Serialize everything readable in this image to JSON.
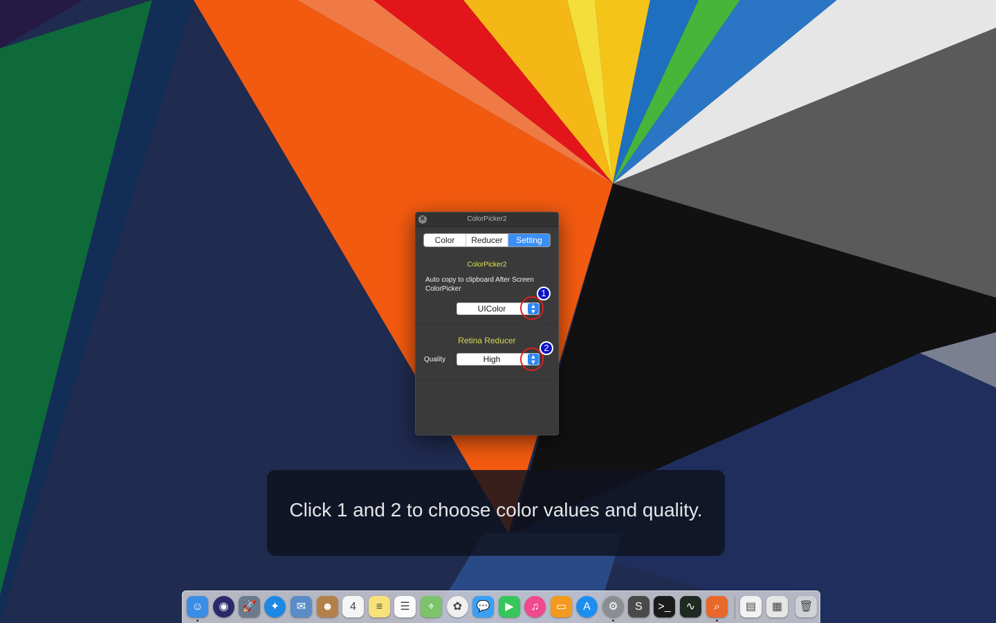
{
  "window": {
    "title": "ColorPicker2",
    "tabs": [
      "Color",
      "Reducer",
      "Setting"
    ],
    "active_tab": "Setting",
    "section1": {
      "title": "ColorPicker2",
      "description": "Auto copy to clipboard After Screen ColorPicker",
      "format_value": "UIColor"
    },
    "section2": {
      "title": "Retina Reducer",
      "quality_label": "Quality",
      "quality_value": "High"
    }
  },
  "annotations": {
    "marker1": "1",
    "marker2": "2"
  },
  "caption": "Click 1 and 2 to choose color values and quality.",
  "dock": {
    "items": [
      {
        "name": "finder-icon",
        "glyph": "☺",
        "color": "#3a8ee6"
      },
      {
        "name": "siri-icon",
        "glyph": "◉",
        "color": "#2a2a6a"
      },
      {
        "name": "launchpad-icon",
        "glyph": "🚀",
        "color": "#6c7a8e"
      },
      {
        "name": "safari-icon",
        "glyph": "✦",
        "color": "#1e88e5"
      },
      {
        "name": "mail-icon",
        "glyph": "✉",
        "color": "#5a8dc8"
      },
      {
        "name": "contacts-icon",
        "glyph": "☻",
        "color": "#b3804a"
      },
      {
        "name": "calendar-icon",
        "glyph": "4",
        "color": "#f5f5f5"
      },
      {
        "name": "notes-icon",
        "glyph": "≡",
        "color": "#f7e27a"
      },
      {
        "name": "reminders-icon",
        "glyph": "☰",
        "color": "#fafafa"
      },
      {
        "name": "maps-icon",
        "glyph": "⌖",
        "color": "#7cc36a"
      },
      {
        "name": "photos-icon",
        "glyph": "✿",
        "color": "#f0f0f0"
      },
      {
        "name": "messages-icon",
        "glyph": "💬",
        "color": "#3aa0f5"
      },
      {
        "name": "facetime-icon",
        "glyph": "▶",
        "color": "#35c759"
      },
      {
        "name": "itunes-icon",
        "glyph": "♫",
        "color": "#f04a8c"
      },
      {
        "name": "ibooks-icon",
        "glyph": "▭",
        "color": "#f39a1e"
      },
      {
        "name": "app-store-icon",
        "glyph": "A",
        "color": "#1c8ef0"
      },
      {
        "name": "system-preferences-icon",
        "glyph": "⚙",
        "color": "#8a8d92"
      },
      {
        "name": "sublime-text-icon",
        "glyph": "S",
        "color": "#4a4a4a"
      },
      {
        "name": "terminal-icon",
        "glyph": ">_",
        "color": "#1b1b1b"
      },
      {
        "name": "activity-monitor-icon",
        "glyph": "∿",
        "color": "#1f2a22"
      },
      {
        "name": "colorpicker-icon",
        "glyph": "⌕",
        "color": "#e8682a"
      },
      {
        "name": "document-stack-icon",
        "glyph": "▤",
        "color": "#f2f2f2"
      },
      {
        "name": "screenshots-stack-icon",
        "glyph": "▦",
        "color": "#e6e6e6"
      },
      {
        "name": "trash-icon",
        "glyph": "🗑",
        "color": "#cfd3d8"
      }
    ]
  }
}
